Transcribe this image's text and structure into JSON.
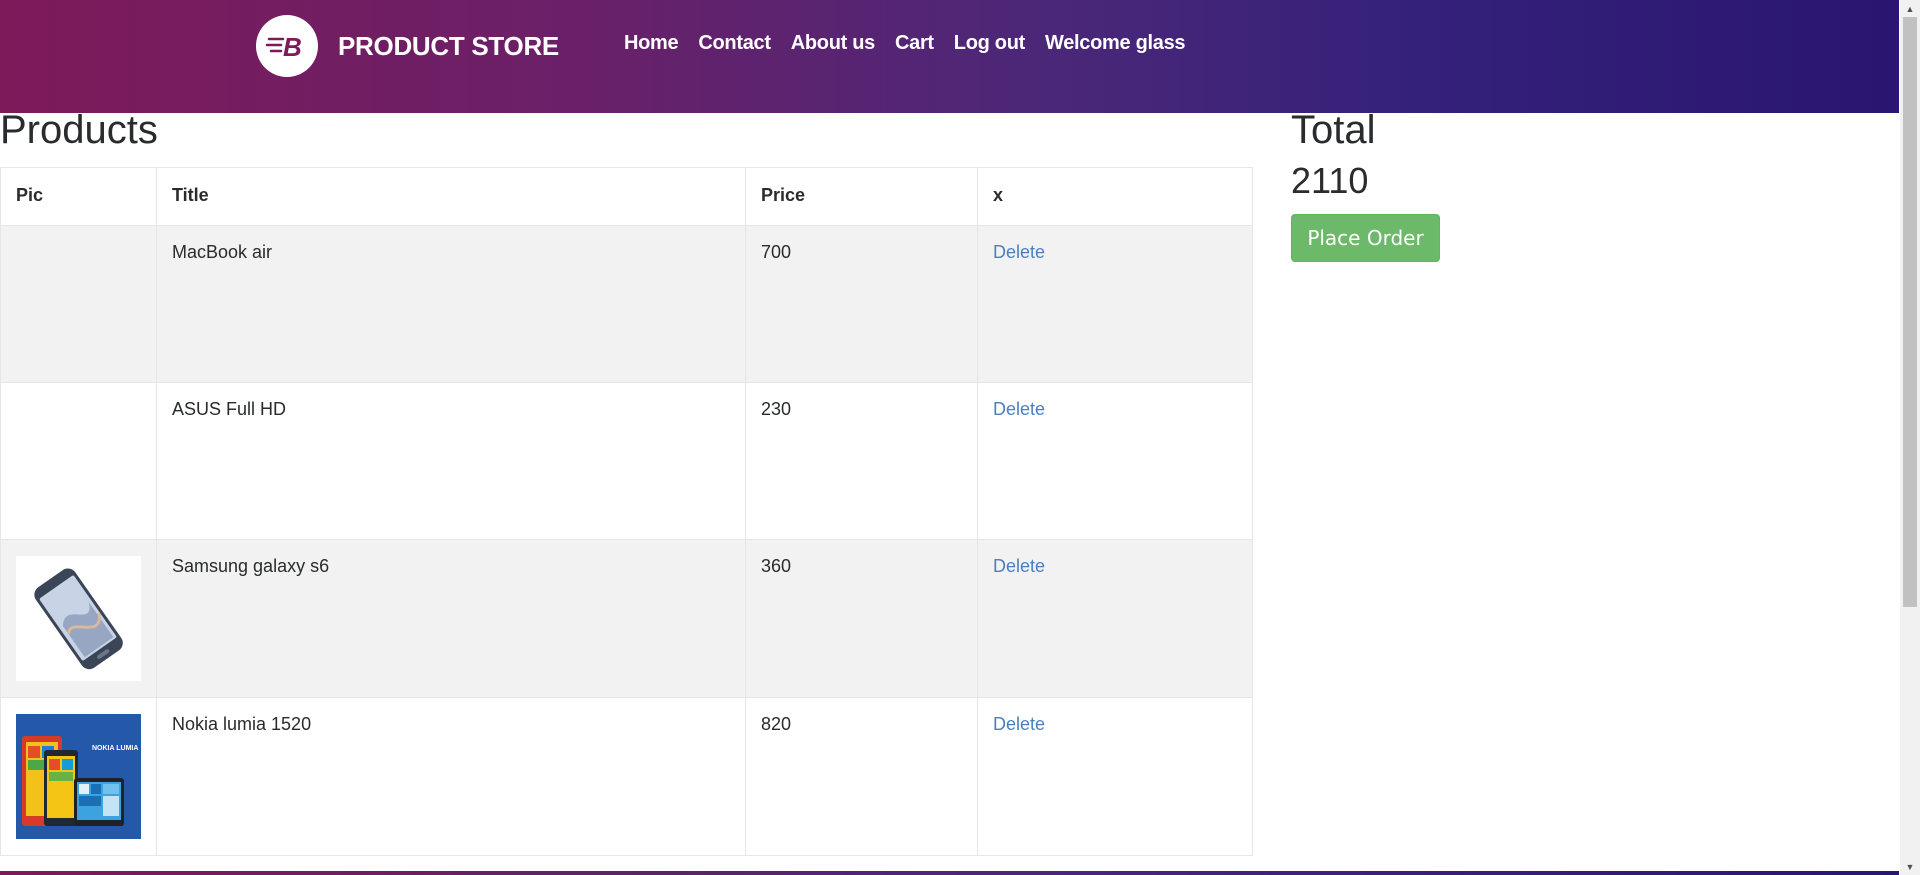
{
  "navbar": {
    "brand_text": "PRODUCT STORE",
    "logo_letter": "B",
    "links": [
      {
        "label": "Home"
      },
      {
        "label": "Contact"
      },
      {
        "label": "About us"
      },
      {
        "label": "Cart"
      },
      {
        "label": "Log out"
      },
      {
        "label": "Welcome glass"
      }
    ]
  },
  "products": {
    "title": "Products",
    "columns": [
      "Pic",
      "Title",
      "Price",
      "x"
    ],
    "rows": [
      {
        "pic": "",
        "title": "MacBook air",
        "price": "700",
        "action": "Delete"
      },
      {
        "pic": "",
        "title": "ASUS Full HD",
        "price": "230",
        "action": "Delete"
      },
      {
        "pic": "samsung-galaxy-s6-image",
        "title": "Samsung galaxy s6",
        "price": "360",
        "action": "Delete"
      },
      {
        "pic": "nokia-lumia-1520-image",
        "title": "Nokia lumia 1520",
        "price": "820",
        "action": "Delete"
      }
    ]
  },
  "total": {
    "title": "Total",
    "value": "2110",
    "place_order_label": "Place Order"
  },
  "nokia_image_text": "NOKIA LUMIA",
  "colors": {
    "navbar_start": "#7d1a5a",
    "navbar_end": "#2a1670",
    "link": "#4a7fc1",
    "place_order": "#6cb96a"
  }
}
